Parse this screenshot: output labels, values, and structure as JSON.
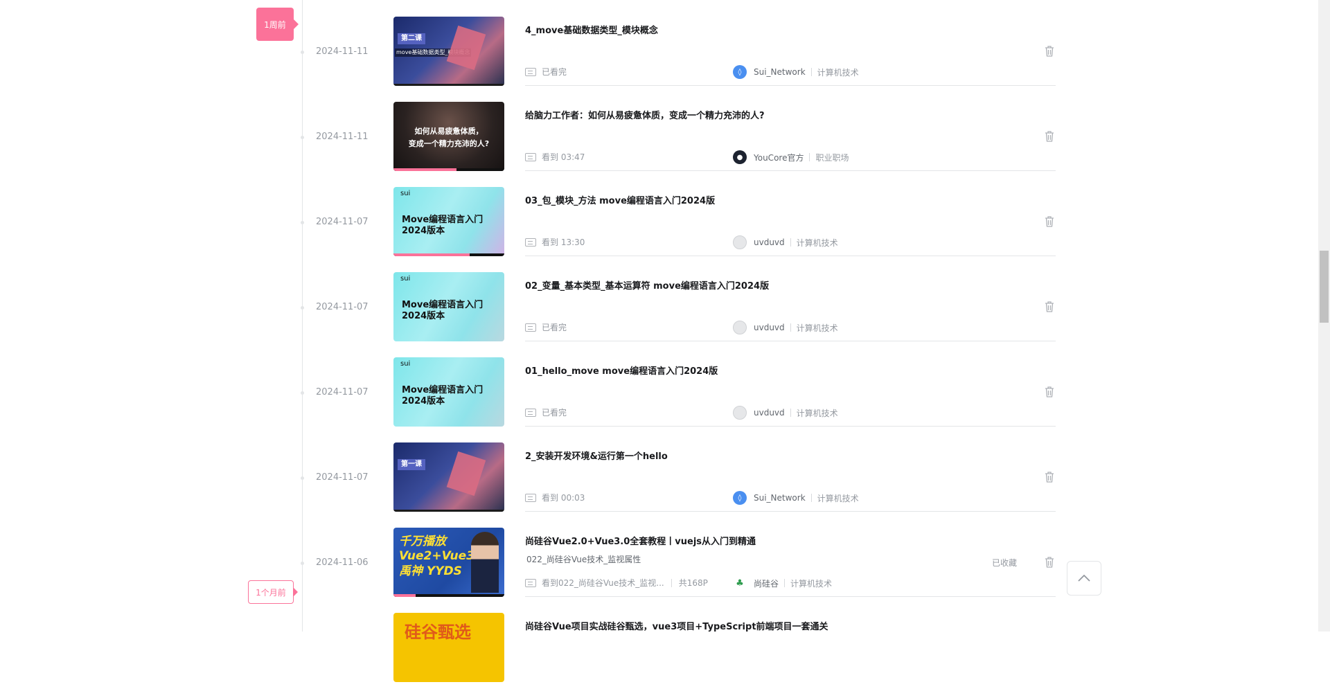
{
  "timeline": {
    "week_label": "1周前",
    "month_label": "1个月前"
  },
  "entries": [
    {
      "date": "2024-11-11",
      "title": "4_move基础数据类型_模块概念",
      "watch": "已看完",
      "author": "Sui_Network",
      "tag": "计算机技术",
      "thumb_text": "第二课",
      "thumb_sub": "move基础数据类型_模块概念"
    },
    {
      "date": "2024-11-11",
      "title": "给脑力工作者：如何从易疲惫体质，变成一个精力充沛的人?",
      "watch": "看到  03:47",
      "author": "YouCore官方",
      "tag": "职业职场",
      "thumb_text": "如何从易疲惫体质，\n变成一个精力充沛的人?",
      "progress": 0.57
    },
    {
      "date": "2024-11-07",
      "title": "03_包_模块_方法 move编程语言入门2024版",
      "watch": "看到  13:30",
      "author": "uvduvd",
      "tag": "计算机技术",
      "thumb_logo": "sui",
      "thumb_text": "Move编程语言入门\n2024版本",
      "progress": 0.69
    },
    {
      "date": "2024-11-07",
      "title": "02_变量_基本类型_基本运算符 move编程语言入门2024版",
      "watch": "已看完",
      "author": "uvduvd",
      "tag": "计算机技术",
      "thumb_logo": "sui",
      "thumb_text": "Move编程语言入门\n2024版本"
    },
    {
      "date": "2024-11-07",
      "title": "01_hello_move move编程语言入门2024版",
      "watch": "已看完",
      "author": "uvduvd",
      "tag": "计算机技术",
      "thumb_logo": "sui",
      "thumb_text": "Move编程语言入门\n2024版本"
    },
    {
      "date": "2024-11-07",
      "title": "2_安装开发环境&运行第一个hello",
      "watch": "看到  00:03",
      "author": "Sui_Network",
      "tag": "计算机技术",
      "thumb_text": "第一课"
    },
    {
      "date": "2024-11-06",
      "title": "尚硅谷Vue2.0+Vue3.0全套教程丨vuejs从入门到精通",
      "subtitle": "022_尚硅谷Vue技术_监视属性",
      "watch": "看到022_尚硅谷Vue技术_监视...",
      "parts": "共168P",
      "author": "尚硅谷",
      "tag": "计算机技术",
      "favorited": "已收藏",
      "thumb_text": "千万播放\nVue2+Vue3\n禹神 YYDS",
      "progress": 0.2
    },
    {
      "date": "",
      "title": "尚硅谷Vue项目实战硅谷甄选，vue3项目+TypeScript前端项目一套通关",
      "thumb_text": "硅谷甄选"
    }
  ]
}
